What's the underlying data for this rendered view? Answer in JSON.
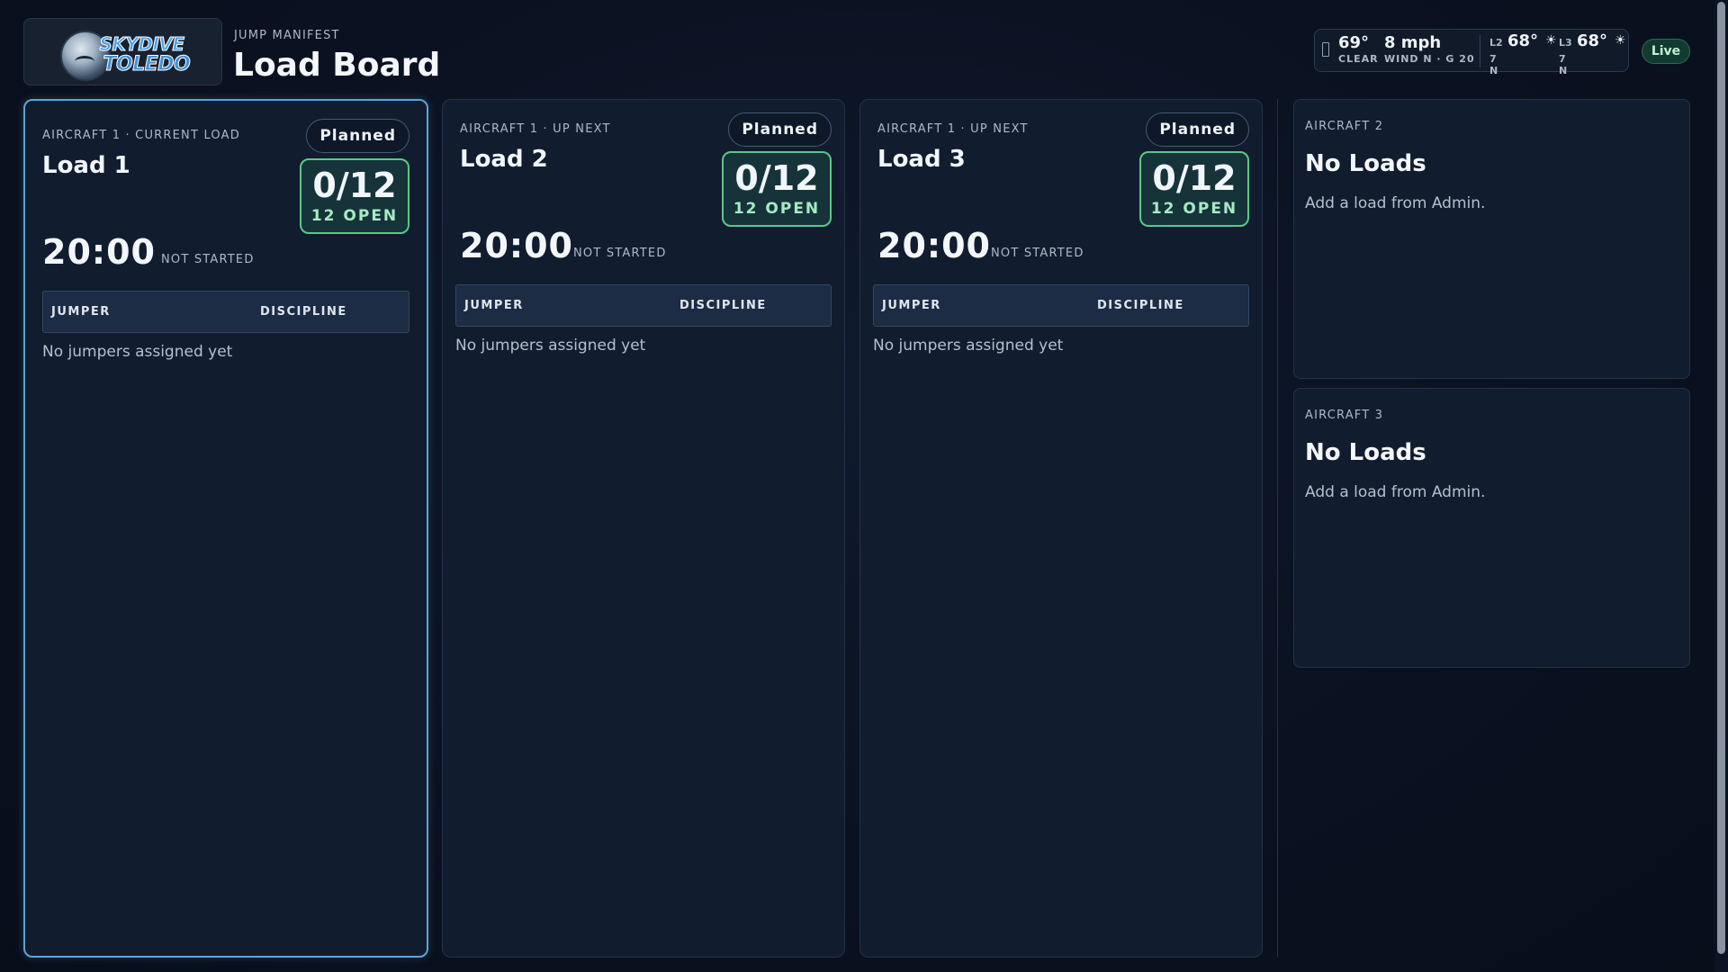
{
  "header": {
    "logo_line1": "SKYDIVE",
    "logo_line2": "TOLEDO",
    "eyebrow": "JUMP MANIFEST",
    "title": "Load Board",
    "live_label": "Live"
  },
  "weather": {
    "temp": "69°",
    "condition": "CLEAR",
    "wind": "8 mph",
    "wind_detail": "WIND N · G 20",
    "levels": [
      {
        "tag": "L2",
        "temp": "68°",
        "icon": "sun-icon",
        "glyph": "☀",
        "wind": "7 N"
      },
      {
        "tag": "L3",
        "temp": "68°",
        "icon": "sun-icon",
        "glyph": "☀",
        "wind": "7 N"
      }
    ]
  },
  "loads": [
    {
      "aircraft_label": "AIRCRAFT 1 · CURRENT LOAD",
      "name": "Load 1",
      "status": "Planned",
      "slots": "0/12",
      "open": "12 OPEN",
      "timer": "20:00",
      "timer_status": "NOT STARTED",
      "col_jumper": "JUMPER",
      "col_discipline": "DISCIPLINE",
      "empty": "No jumpers assigned yet"
    },
    {
      "aircraft_label": "AIRCRAFT 1 · UP NEXT",
      "name": "Load 2",
      "status": "Planned",
      "slots": "0/12",
      "open": "12 OPEN",
      "timer": "20:00",
      "timer_status": "NOT STARTED",
      "col_jumper": "JUMPER",
      "col_discipline": "DISCIPLINE",
      "empty": "No jumpers assigned yet"
    },
    {
      "aircraft_label": "AIRCRAFT 1 · UP NEXT",
      "name": "Load 3",
      "status": "Planned",
      "slots": "0/12",
      "open": "12 OPEN",
      "timer": "20:00",
      "timer_status": "NOT STARTED",
      "col_jumper": "JUMPER",
      "col_discipline": "DISCIPLINE",
      "empty": "No jumpers assigned yet"
    }
  ],
  "other_aircraft": [
    {
      "aircraft_label": "AIRCRAFT 2",
      "title": "No Loads",
      "hint": "Add a load from Admin."
    },
    {
      "aircraft_label": "AIRCRAFT 3",
      "title": "No Loads",
      "hint": "Add a load from Admin."
    }
  ],
  "colors": {
    "background": "#0a1120",
    "card": "#111c2e",
    "current_border": "#5aa4d6",
    "open_green": "#58c98a",
    "live_bg": "#133a30"
  }
}
